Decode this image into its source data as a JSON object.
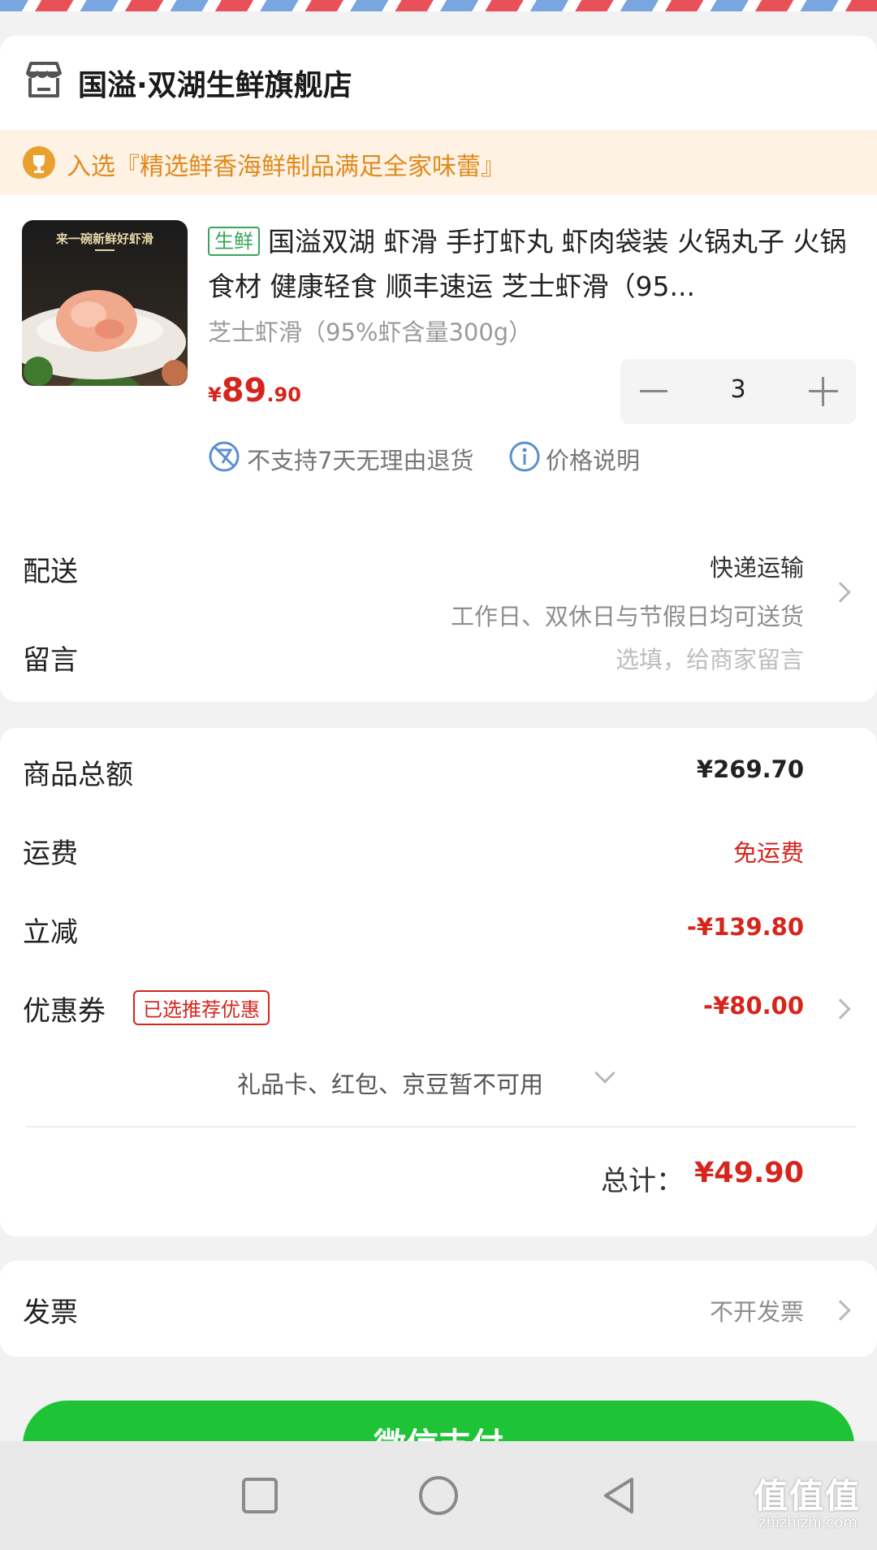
{
  "store": {
    "name": "国溢·双湖生鲜旗舰店"
  },
  "banner": {
    "text": "入选『精选鲜香海鲜制品满足全家味蕾』"
  },
  "product": {
    "image_caption": "来一碗新鲜好虾滑",
    "tag": "生鲜",
    "title": "国溢双湖 虾滑 手打虾丸 虾肉袋装 火锅丸子 火锅食材 健康轻食 顺丰速运 芝士虾滑（95...",
    "spec": "芝士虾滑（95%虾含量300g）",
    "price_symbol": "¥",
    "price_int": "89",
    "price_dec": ".90",
    "quantity": "3",
    "no_return": "不支持7天无理由退货",
    "price_info": "价格说明"
  },
  "delivery": {
    "label": "配送",
    "method": "快递运输",
    "note": "工作日、双休日与节假日均可送货"
  },
  "message": {
    "label": "留言",
    "placeholder": "选填，给商家留言"
  },
  "summary": {
    "goods_label": "商品总额",
    "goods_value": "¥269.70",
    "shipping_label": "运费",
    "shipping_value": "免运费",
    "discount_label": "立减",
    "discount_value": "-¥139.80",
    "coupon_label": "优惠券",
    "coupon_badge": "已选推荐优惠",
    "coupon_value": "-¥80.00",
    "unavailable": "礼品卡、红包、京豆暂不可用",
    "total_label": "总计：",
    "total_value": "¥49.90"
  },
  "invoice": {
    "label": "发票",
    "value": "不开发票"
  },
  "pay_button": {
    "label": "微信支付"
  },
  "watermark": {
    "text": "值值值",
    "url": "zhizhizhi.com"
  },
  "colors": {
    "accent": "#d6251d",
    "pay_green": "#1ec436",
    "banner_bg": "#fdf2e4",
    "banner_text": "#e18a1d",
    "tag_green": "#3aa55a"
  }
}
